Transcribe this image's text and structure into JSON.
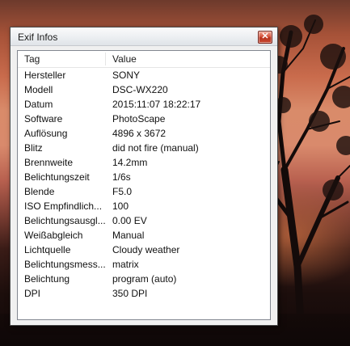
{
  "window": {
    "title": "Exif Infos",
    "close_glyph": "✕"
  },
  "table": {
    "headers": {
      "tag": "Tag",
      "value": "Value"
    },
    "rows": [
      {
        "tag": "Hersteller",
        "value": "SONY"
      },
      {
        "tag": "Modell",
        "value": "DSC-WX220"
      },
      {
        "tag": "Datum",
        "value": "2015:11:07 18:22:17"
      },
      {
        "tag": "Software",
        "value": "PhotoScape"
      },
      {
        "tag": "Auflösung",
        "value": "4896 x 3672"
      },
      {
        "tag": "Blitz",
        "value": "did not fire (manual)"
      },
      {
        "tag": "Brennweite",
        "value": "14.2mm"
      },
      {
        "tag": "Belichtungszeit",
        "value": "1/6s"
      },
      {
        "tag": "Blende",
        "value": "F5.0"
      },
      {
        "tag": "ISO Empfindlich...",
        "value": "100"
      },
      {
        "tag": "Belichtungsausgl...",
        "value": "0.00 EV"
      },
      {
        "tag": "Weißabgleich",
        "value": "Manual"
      },
      {
        "tag": "Lichtquelle",
        "value": "Cloudy weather"
      },
      {
        "tag": "Belichtungsmess...",
        "value": "matrix"
      },
      {
        "tag": "Belichtung",
        "value": "program (auto)"
      },
      {
        "tag": "DPI",
        "value": "350 DPI"
      }
    ]
  },
  "colors": {
    "close_button": "#c84a31",
    "window_bg": "#f0f0f0",
    "list_border": "#828790"
  }
}
